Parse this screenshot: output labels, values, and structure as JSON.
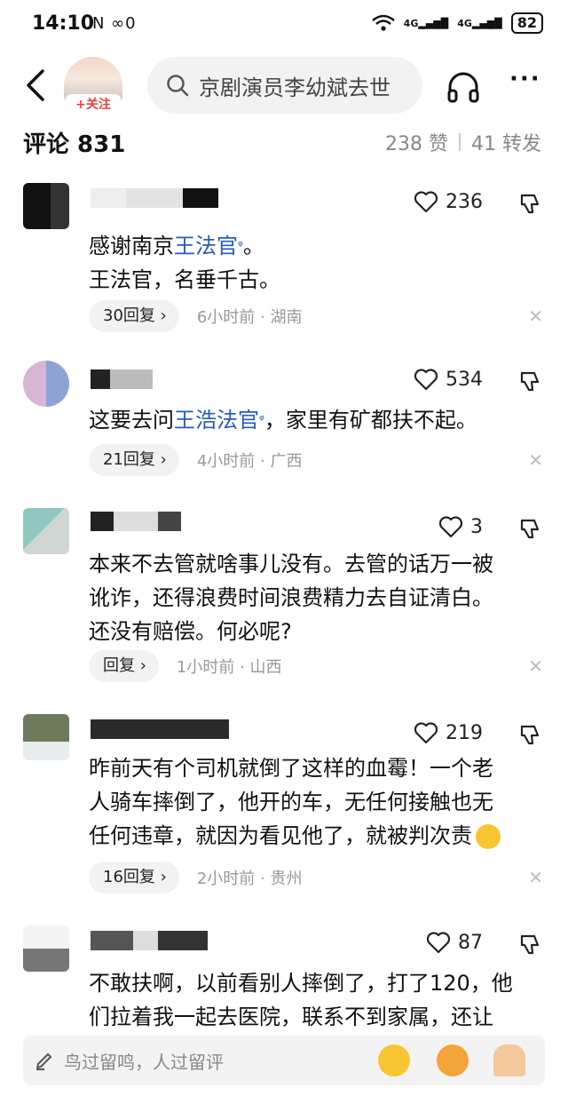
{
  "status": {
    "time": "14:10",
    "sys_icons": "N ∞0",
    "net1": "4G",
    "net2": "4G",
    "battery": "82"
  },
  "topbar": {
    "follow_label": "+关注",
    "search_text": "京剧演员李幼斌去世"
  },
  "counts": {
    "title": "评论 831",
    "likes": "238 赞",
    "reposts": "41 转发"
  },
  "comments": [
    {
      "likes": "236",
      "text_prefix": "感谢南京",
      "link": "王法官",
      "text_suffix": "。",
      "line2": "王法官，名垂千古。",
      "reply": "30回复",
      "time": "6小时前 · 湖南"
    },
    {
      "likes": "534",
      "text_prefix": "这要去问",
      "link": "王浩法官",
      "text_suffix": "，家里有矿都扶不起。",
      "reply": "21回复",
      "time": "4小时前 · 广西"
    },
    {
      "likes": "3",
      "line1": "本来不去管就啥事儿没有。去管的话万一被",
      "line2": "讹诈，还得浪费时间浪费精力去自证清白。",
      "line3": "还没有赔偿。何必呢?",
      "reply": "回复",
      "time": "1小时前 · 山西"
    },
    {
      "likes": "219",
      "line1": "昨前天有个司机就倒了这样的血霉！一个老",
      "line2": "人骑车摔倒了，他开的车，无任何接触也无",
      "line3": "任何违章，就因为看见他了，就被判次责",
      "reply": "16回复",
      "time": "2小时前 · 贵州"
    },
    {
      "likes": "87",
      "line1": "不敢扶啊，以前看别人摔倒了，打了120，他",
      "line2": "们拉着我一起去医院，联系不到家属，还让"
    }
  ],
  "bottombar": {
    "placeholder": "鸟过留鸣，人过留评"
  },
  "colors": {
    "link": "#2a5cb0",
    "follow": "#e8433b",
    "meta": "#999999"
  },
  "icons": [
    "back-arrow-icon",
    "search-icon",
    "headphones-icon",
    "more-icon",
    "heart-icon",
    "thumbs-down-icon",
    "close-icon",
    "pen-icon",
    "crying-emoji-icon",
    "angry-emoji-icon",
    "praying-hands-icon"
  ]
}
